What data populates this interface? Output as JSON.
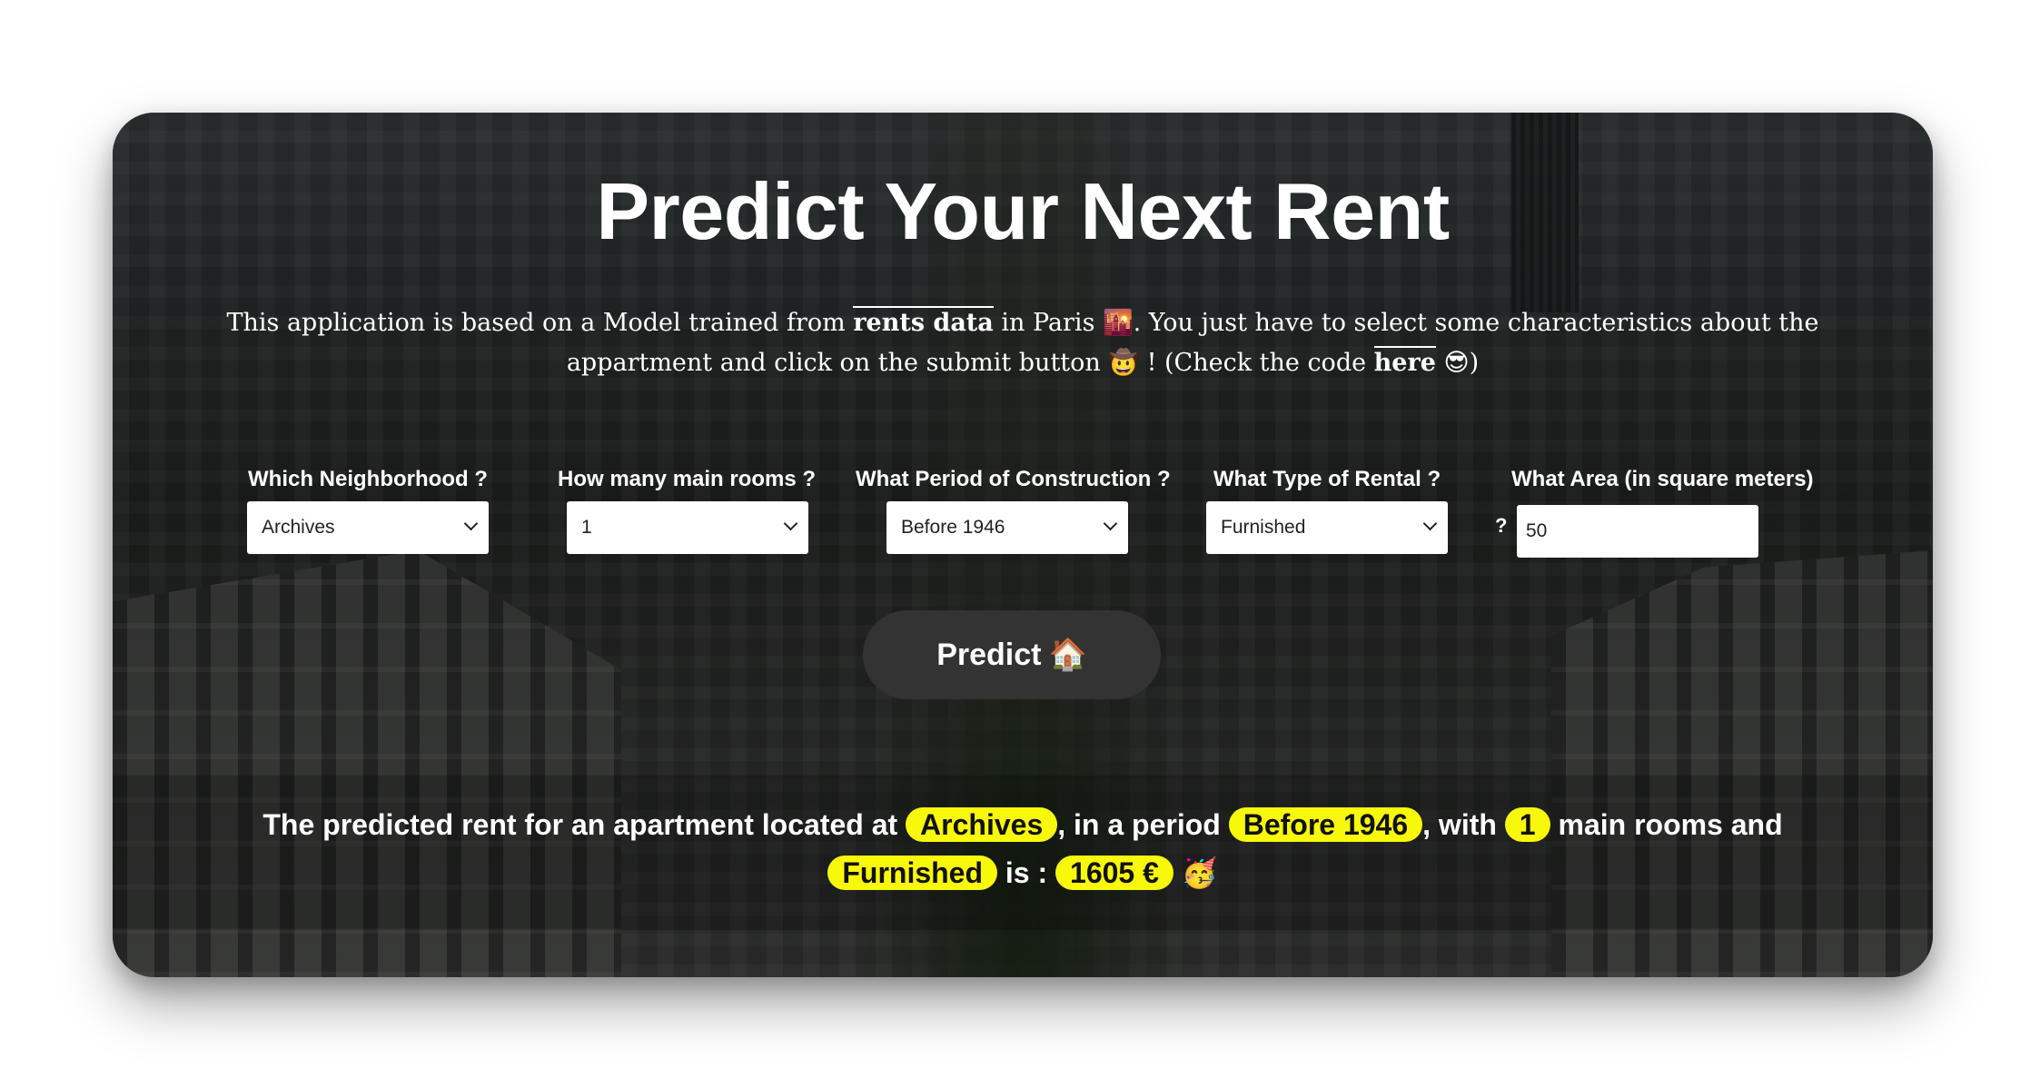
{
  "header": {
    "title": "Predict Your Next Rent"
  },
  "intro": {
    "part1": "This application is based on a Model trained from ",
    "link_rents": "rents data",
    "part2": " in Paris ",
    "emoji_city": "🌇",
    "part3": ". You just have to select some characteristics about the appartment and click on the submit button ",
    "emoji_cowboy": "🤠",
    "part4": " ! (Check the code ",
    "link_here": "here",
    "emoji_cool": "😎",
    "part5": ")"
  },
  "form": {
    "neighborhood": {
      "label": "Which Neighborhood ?",
      "value": "Archives"
    },
    "rooms": {
      "label": "How many main rooms ?",
      "value": "1"
    },
    "period": {
      "label": "What Period of Construction ?",
      "value": "Before 1946"
    },
    "rental_type": {
      "label": "What Type of Rental ?",
      "value": "Furnished"
    },
    "area": {
      "label": "What Area (in square meters)",
      "label_suffix": "?",
      "value": "50"
    }
  },
  "predict_button": {
    "label": "Predict",
    "emoji": "🏠"
  },
  "result": {
    "t1": "The predicted rent for an apartment located at ",
    "neighborhood": "Archives",
    "t2": ", in a period ",
    "period": "Before 1946",
    "t3": ", with ",
    "rooms": "1",
    "t4": " main rooms and ",
    "rental_type": "Furnished",
    "t5": " is : ",
    "rent": "1605 €",
    "emoji": "🥳"
  },
  "colors": {
    "highlight": "#f8f80a",
    "button": "#333333",
    "text": "#ffffff"
  }
}
